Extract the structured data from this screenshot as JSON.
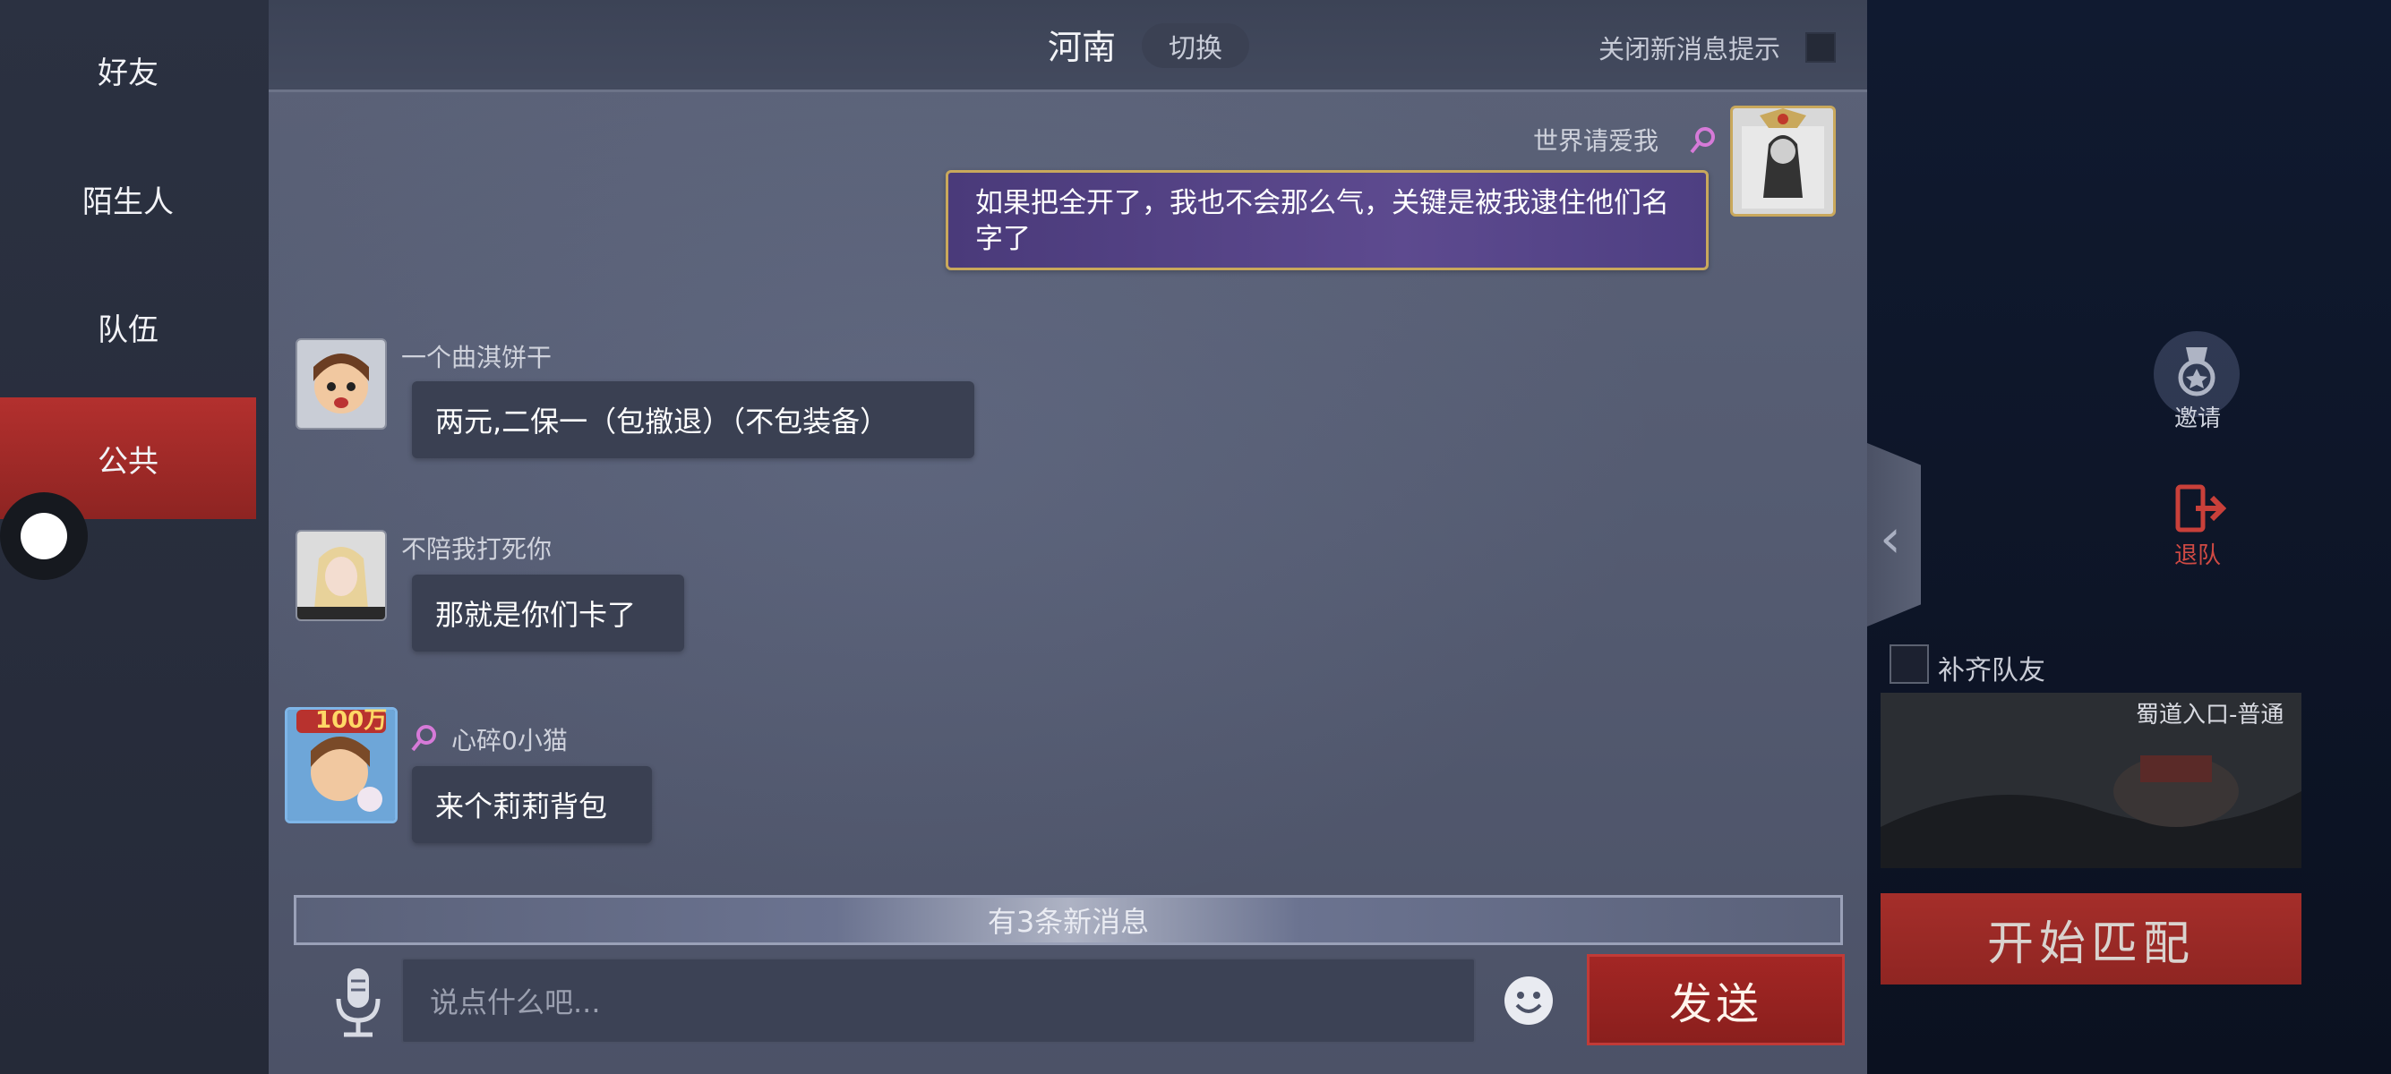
{
  "nav": {
    "items": [
      {
        "label": "好友",
        "active": false
      },
      {
        "label": "陌生人",
        "active": false
      },
      {
        "label": "队伍",
        "active": false
      },
      {
        "label": "公共",
        "active": true
      }
    ]
  },
  "header": {
    "region": "河南",
    "switch_label": "切换",
    "notify_label": "关闭新消息提示"
  },
  "messages": [
    {
      "sender": "世界请爱我",
      "text": "如果把全开了，我也不会那么气，关键是被我逮住他们名字了",
      "own": true
    },
    {
      "sender": "一个曲淇饼干",
      "text": "两元,二保一（包撤退）（不包装备）",
      "own": false
    },
    {
      "sender": "不陪我打死你",
      "text": "那就是你们卡了",
      "own": false
    },
    {
      "sender": "心碎0小猫",
      "text": "来个莉莉背包",
      "own": false,
      "badge": "100万"
    }
  ],
  "new_messages_bar": "有3条新消息",
  "input": {
    "placeholder": "说点什么吧..."
  },
  "send_label": "发送",
  "side": {
    "invite_label": "邀请",
    "leave_label": "退队",
    "refill_label": "补齐队友",
    "map_label": "蜀道入口-普通",
    "start_label": "开始匹配"
  },
  "colors": {
    "accent_red": "#a32624",
    "own_bubble": "#5d4a8f",
    "own_bubble_border": "#c9a85c",
    "female_icon": "#d67ad8"
  }
}
